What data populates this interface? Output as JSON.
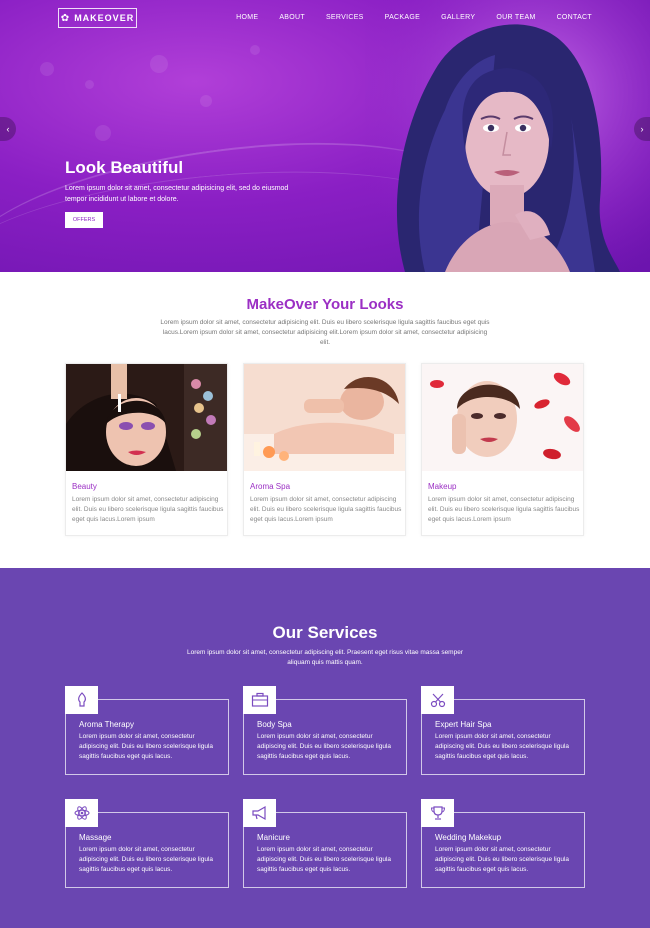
{
  "brand": {
    "logo_text": "MAKEOVER"
  },
  "nav": {
    "items": [
      "HOME",
      "ABOUT",
      "SERVICES",
      "PACKAGE",
      "GALLERY",
      "OUR TEAM",
      "CONTACT"
    ]
  },
  "hero": {
    "title": "Look Beautiful",
    "text": "Lorem ipsum dolor sit amet, consectetur adipisicing elit, sed do eiusmod tempor incididunt ut labore et dolore.",
    "button_label": "OFFERS",
    "prev_label": "‹",
    "next_label": "›"
  },
  "looks": {
    "title": "MakeOver Your Looks",
    "subtitle": "Lorem ipsum dolor sit amet, consectetur adipisicing elit. Duis eu libero scelerisque ligula sagittis faucibus eget quis lacus.Lorem ipsum dolor sit amet, consectetur adipisicing elit.Lorem ipsum dolor sit amet, consectetur adipisicing elit.",
    "cards": [
      {
        "title": "Beauty",
        "text": "Lorem ipsum dolor sit amet, consectetur adipiscing elit. Duis eu libero scelerisque ligula sagittis faucibus eget quis lacus.Lorem ipsum"
      },
      {
        "title": "Aroma Spa",
        "text": "Lorem ipsum dolor sit amet, consectetur adipiscing elit. Duis eu libero scelerisque ligula sagittis faucibus eget quis lacus.Lorem ipsum"
      },
      {
        "title": "Makeup",
        "text": "Lorem ipsum dolor sit amet, consectetur adipiscing elit. Duis eu libero scelerisque ligula sagittis faucibus eget quis lacus.Lorem ipsum"
      }
    ]
  },
  "services": {
    "title": "Our Services",
    "subtitle": "Lorem ipsum dolor sit amet, consectetur adipiscing elit. Praesent eget risus vitae massa semper aliquam quis mattis quam.",
    "items": [
      {
        "title": "Aroma Therapy",
        "icon": "aroma-icon",
        "text": "Lorem ipsum dolor sit amet, consectetur adipiscing elit. Duis eu libero scelerisque ligula sagittis faucibus eget quis lacus."
      },
      {
        "title": "Body Spa",
        "icon": "briefcase-icon",
        "text": "Lorem ipsum dolor sit amet, consectetur adipiscing elit. Duis eu libero scelerisque ligula sagittis faucibus eget quis lacus."
      },
      {
        "title": "Expert Hair Spa",
        "icon": "scissors-icon",
        "text": "Lorem ipsum dolor sit amet, consectetur adipiscing elit. Duis eu libero scelerisque ligula sagittis faucibus eget quis lacus."
      },
      {
        "title": "Massage",
        "icon": "atom-icon",
        "text": "Lorem ipsum dolor sit amet, consectetur adipiscing elit. Duis eu libero scelerisque ligula sagittis faucibus eget quis lacus."
      },
      {
        "title": "Manicure",
        "icon": "megaphone-icon",
        "text": "Lorem ipsum dolor sit amet, consectetur adipiscing elit. Duis eu libero scelerisque ligula sagittis faucibus eget quis lacus."
      },
      {
        "title": "Wedding Makekup",
        "icon": "trophy-icon",
        "text": "Lorem ipsum dolor sit amet, consectetur adipiscing elit. Duis eu libero scelerisque ligula sagittis faucibus eget quis lacus."
      }
    ]
  },
  "colors": {
    "accent": "#9b2fc4",
    "services_bg": "#6a46b1",
    "hero_bg": "#8a1fc4"
  }
}
